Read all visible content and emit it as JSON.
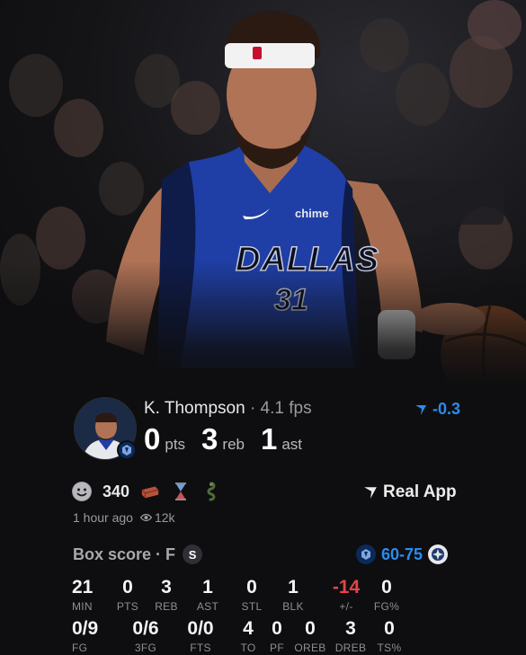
{
  "player": {
    "name": "K. Thompson",
    "separator": "·",
    "fps": "4.1 fps",
    "line": [
      {
        "value": "0",
        "unit": "pts"
      },
      {
        "value": "3",
        "unit": "reb"
      },
      {
        "value": "1",
        "unit": "ast"
      }
    ],
    "delta": "-0.3",
    "jersey_text": "DALLAS",
    "jersey_number": "31",
    "sponsor": "chime"
  },
  "reactions": {
    "count": "340",
    "icons": [
      "smile-icon",
      "brick-icon",
      "hourglass-icon",
      "snake-icon"
    ]
  },
  "real_app_label": "Real App",
  "meta": {
    "time": "1 hour ago",
    "views": "12k"
  },
  "box_score": {
    "title": "Box score · F",
    "s_badge": "S",
    "score": "60-75",
    "row1": [
      {
        "value": "21",
        "label": "MIN"
      },
      {
        "value": "0",
        "label": "PTS"
      },
      {
        "value": "3",
        "label": "REB"
      },
      {
        "value": "1",
        "label": "AST"
      },
      {
        "value": "0",
        "label": "STL"
      },
      {
        "value": "1",
        "label": "BLK"
      },
      {
        "value": "-14",
        "label": "+/-"
      },
      {
        "value": "0",
        "label": "FG%"
      }
    ],
    "row2": [
      {
        "value": "0/9",
        "label": "FG"
      },
      {
        "value": "0/6",
        "label": "3FG"
      },
      {
        "value": "0/0",
        "label": "FTS"
      },
      {
        "value": "4",
        "label": "TO"
      },
      {
        "value": "0",
        "label": "PF"
      },
      {
        "value": "0",
        "label": "OREB"
      },
      {
        "value": "3",
        "label": "DREB"
      },
      {
        "value": "0",
        "label": "TS%"
      }
    ]
  },
  "colors": {
    "accent": "#2a8cf0",
    "negative": "#e8424b",
    "background": "#0e0e10",
    "jersey": "#1f3fa6"
  }
}
